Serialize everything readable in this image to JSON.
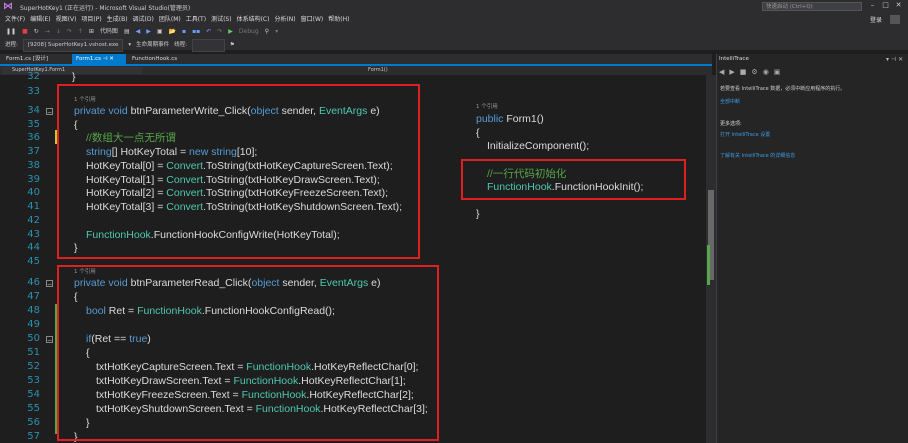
{
  "window": {
    "title": "SuperHotKey1 (正在运行) - Microsoft Visual Studio(管理员)",
    "quick_launch_placeholder": "快速启动 (Ctrl+Q)",
    "login": "登录"
  },
  "menu": [
    "文件(F)",
    "编辑(E)",
    "视图(V)",
    "项目(P)",
    "生成(B)",
    "调试(D)",
    "团队(M)",
    "工具(T)",
    "测试(S)",
    "体系结构(C)",
    "分析(N)",
    "窗口(W)",
    "帮助(H)"
  ],
  "toolbar": {
    "code_map": "代码图",
    "debug_mode": "Debug"
  },
  "process_bar": {
    "process_label": "进程:",
    "process_value": "[9208] SuperHotKey1.vshost.exe",
    "lifecycle": "生命周期事件",
    "thread": "线程:"
  },
  "tabs": [
    {
      "label": "Form1.cs [设计]"
    },
    {
      "label": "Form1.cs"
    },
    {
      "label": "FunctionHook.cs"
    }
  ],
  "nav": {
    "class_combo": "SuperHotKey1.Form1",
    "member_combo": "Form1()"
  },
  "editor": {
    "line_numbers": [
      "32",
      "33",
      "34",
      "35",
      "36",
      "37",
      "38",
      "39",
      "40",
      "41",
      "42",
      "43",
      "44",
      "45",
      "46",
      "47",
      "48",
      "49",
      "50",
      "51",
      "52",
      "53",
      "54",
      "55",
      "56",
      "57"
    ],
    "ref1": "1 个引用",
    "ref2": "1 个引用",
    "ref3": "1 个引用",
    "lines": {
      "l32": "}",
      "l34a": "private void ",
      "l34b": "btnParameterWrite_Click(",
      "l34c": "object",
      "l34d": " sender, ",
      "l34e": "EventArgs",
      "l34f": " e)",
      "l35": "{",
      "l36": "//数组大一点无所谓",
      "l37a": "string",
      "l37b": "[] HotKeyTotal = ",
      "l37c": "new",
      "l37d": " string",
      "l37e": "[10];",
      "l38a": "HotKeyTotal[0] = ",
      "l38b": "Convert",
      "l38c": ".ToString(txtHotKeyCaptureScreen.Text);",
      "l39a": "HotKeyTotal[1] = ",
      "l39b": "Convert",
      "l39c": ".ToString(txtHotKeyDrawScreen.Text);",
      "l40a": "HotKeyTotal[2] = ",
      "l40b": "Convert",
      "l40c": ".ToString(txtHotKeyFreezeScreen.Text);",
      "l41a": "HotKeyTotal[3] = ",
      "l41b": "Convert",
      "l41c": ".ToString(txtHotKeyShutdownScreen.Text);",
      "l43a": "FunctionHook",
      "l43b": ".FunctionHookConfigWrite(HotKeyTotal);",
      "l44": "}",
      "l46a": "private void ",
      "l46b": "btnParameterRead_Click(",
      "l46c": "object",
      "l46d": " sender, ",
      "l46e": "EventArgs",
      "l46f": " e)",
      "l47": "{",
      "l48a": "bool",
      "l48b": " Ret = ",
      "l48c": "FunctionHook",
      "l48d": ".FunctionHookConfigRead();",
      "l50a": "if",
      "l50b": "(Ret == ",
      "l50c": "true",
      "l50d": ")",
      "l51": "{",
      "l52a": "txtHotKeyCaptureScreen.Text = ",
      "l52b": "FunctionHook",
      "l52c": ".HotKeyReflectChar[0];",
      "l53a": "txtHotKeyDrawScreen.Text = ",
      "l53b": "FunctionHook",
      "l53c": ".HotKeyReflectChar[1];",
      "l54a": "txtHotKeyFreezeScreen.Text = ",
      "l54b": "FunctionHook",
      "l54c": ".HotKeyReflectChar[2];",
      "l55a": "txtHotKeyShutdownScreen.Text = ",
      "l55b": "FunctionHook",
      "l55c": ".HotKeyReflectChar[3];",
      "l56": "}",
      "l57": "}"
    },
    "side": {
      "s1a": "public",
      "s1b": " Form1()",
      "s2": "{",
      "s3": "InitializeComponent();",
      "s4": "//一行代码初始化",
      "s5a": "FunctionHook",
      "s5b": ".FunctionHookInit();",
      "s6": "}"
    }
  },
  "intellitrace": {
    "title": "IntelliTrace",
    "line1": "若要查看 IntelliTrace 数据，必须中断应用程序的执行。",
    "link1": "全部中断",
    "head1": "更多选项:",
    "link2": "打开 IntelliTrace 设置",
    "link3": "了解有关 IntelliTrace 的详细信息"
  },
  "colors": {
    "accent": "#007acc",
    "highlight_box": "#e02020",
    "keyword": "#569cd6",
    "type": "#4ec9b0",
    "comment": "#57a64a"
  }
}
